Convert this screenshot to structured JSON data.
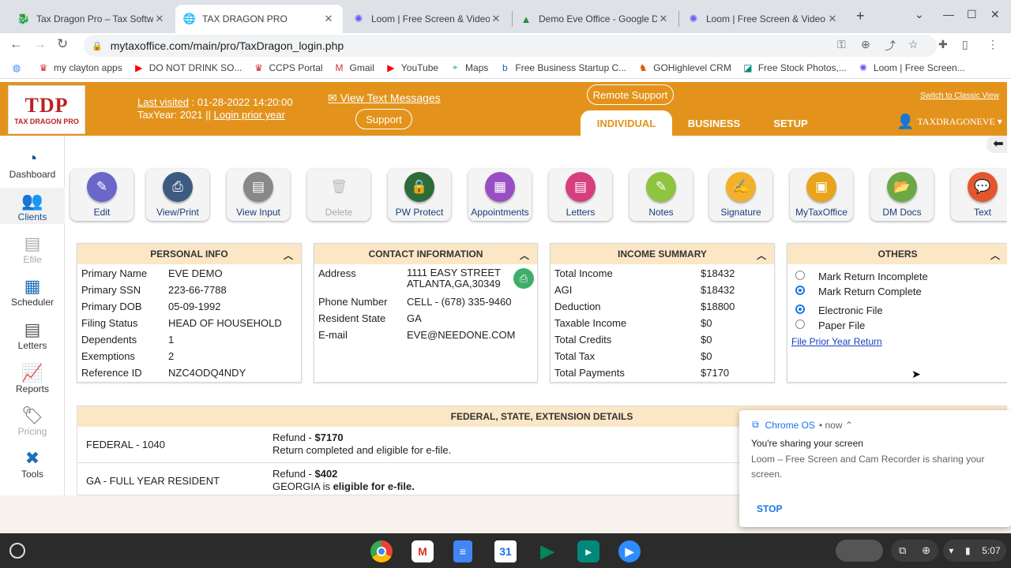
{
  "browser": {
    "tabs": [
      {
        "title": "Tax Dragon Pro – Tax Softwa",
        "icon": "tdp-icon",
        "color": "#c62828"
      },
      {
        "title": "TAX DRAGON PRO",
        "icon": "globe-icon",
        "color": "#5f6368"
      },
      {
        "title": "Loom | Free Screen & Video Re",
        "icon": "loom-icon",
        "color": "#625df5"
      },
      {
        "title": "Demo Eve Office - Google Driv",
        "icon": "drive-icon",
        "color": "#1e8e3e"
      },
      {
        "title": "Loom | Free Screen & Video Re",
        "icon": "loom-icon",
        "color": "#625df5"
      }
    ],
    "new_tab": "+",
    "url": "mytaxoffice.com/main/pro/TaxDragon_login.php",
    "bookmarks": [
      {
        "label": "",
        "icon": "apps-icon"
      },
      {
        "label": "my clayton apps",
        "icon": "bookmark-icon"
      },
      {
        "label": "DO NOT DRINK SO...",
        "icon": "youtube-icon"
      },
      {
        "label": "CCPS Portal",
        "icon": "bookmark-icon"
      },
      {
        "label": "Gmail",
        "icon": "gmail-icon"
      },
      {
        "label": "YouTube",
        "icon": "youtube-icon"
      },
      {
        "label": "Maps",
        "icon": "maps-icon"
      },
      {
        "label": "Free Business Startup C...",
        "icon": "bookmark-icon"
      },
      {
        "label": "GOHighlevel CRM",
        "icon": "bookmark-icon"
      },
      {
        "label": "Free Stock Photos,...",
        "icon": "bookmark-icon"
      },
      {
        "label": "Loom | Free Screen...",
        "icon": "loom-icon"
      }
    ]
  },
  "header": {
    "logo_text": "TDP",
    "logo_sub": "TAX DRAGON PRO",
    "last_visited_label": "Last visited",
    "last_visited_value": " : 01-28-2022 14:20:00",
    "taxyear_label": "TaxYear:  2021  ||",
    "login_prior_year": "Login prior year",
    "view_text_messages": "View Text Messages",
    "remote_support": "Remote Support",
    "support": "Support",
    "switch_classic": "Switch to Classic View",
    "nav_tabs": [
      "INDIVIDUAL",
      "BUSINESS",
      "SETUP"
    ],
    "user": "TAXDRAGONEVE ▾"
  },
  "sidebar": [
    {
      "label": "Dashboard",
      "icon": "dashboard-icon"
    },
    {
      "label": "Clients",
      "icon": "clients-icon"
    },
    {
      "label": "Efile",
      "icon": "efile-icon"
    },
    {
      "label": "Scheduler",
      "icon": "calendar-icon"
    },
    {
      "label": "Letters",
      "icon": "letters-icon"
    },
    {
      "label": "Reports",
      "icon": "reports-icon"
    },
    {
      "label": "Pricing",
      "icon": "pricing-icon"
    },
    {
      "label": "Tools",
      "icon": "tools-icon"
    }
  ],
  "toolbar": [
    {
      "label": "Edit",
      "icon": "edit-icon",
      "color": "#6b66c9"
    },
    {
      "label": "View/Print",
      "icon": "print-icon",
      "color": "#3d5b80"
    },
    {
      "label": "View Input",
      "icon": "view-input-icon",
      "color": "#888888"
    },
    {
      "label": "Delete",
      "icon": "trash-icon",
      "color": "#cccccc"
    },
    {
      "label": "PW Protect",
      "icon": "lock-icon",
      "color": "#2e6b3a"
    },
    {
      "label": "Appointments",
      "icon": "calendar-icon",
      "color": "#9a4ec4"
    },
    {
      "label": "Letters",
      "icon": "letters-icon",
      "color": "#d63f7f"
    },
    {
      "label": "Notes",
      "icon": "notes-icon",
      "color": "#8fc43f"
    },
    {
      "label": "Signature",
      "icon": "signature-icon",
      "color": "#f2b12c"
    },
    {
      "label": "MyTaxOffice",
      "icon": "mytaxoffice-icon",
      "color": "#e8a41b"
    },
    {
      "label": "DM Docs",
      "icon": "folder-icon",
      "color": "#6ea845"
    },
    {
      "label": "Text",
      "icon": "text-icon",
      "color": "#e4572e"
    }
  ],
  "personal": {
    "title": "PERSONAL INFO",
    "rows": [
      [
        "Primary Name",
        "EVE DEMO"
      ],
      [
        "Primary SSN",
        "223-66-7788"
      ],
      [
        "Primary DOB",
        "05-09-1992"
      ],
      [
        "Filing Status",
        "HEAD OF HOUSEHOLD"
      ],
      [
        "Dependents",
        "1"
      ],
      [
        "Exemptions",
        "2"
      ],
      [
        "Reference ID",
        "NZC4ODQ4NDY"
      ]
    ]
  },
  "contact": {
    "title": "CONTACT INFORMATION",
    "address_label": "Address",
    "address_line1": "1111 EASY STREET",
    "address_line2": "ATLANTA,GA,30349",
    "phone_label": "Phone Number",
    "phone": "CELL - (678) 335-9460",
    "state_label": "Resident State",
    "state": "GA",
    "email_label": "E-mail",
    "email": "EVE@NEEDONE.COM"
  },
  "income": {
    "title": "INCOME SUMMARY",
    "rows": [
      [
        "Total Income",
        "$18432"
      ],
      [
        "AGI",
        "$18432"
      ],
      [
        "Deduction",
        "$18800"
      ],
      [
        "Taxable Income",
        "$0"
      ],
      [
        "Total Credits",
        "$0"
      ],
      [
        "Total Tax",
        "$0"
      ],
      [
        "Total Payments",
        "$7170"
      ]
    ]
  },
  "others": {
    "title": "OTHERS",
    "mark_incomplete": "Mark Return Incomplete",
    "mark_complete": "Mark Return Complete",
    "electronic": "Electronic File",
    "paper": "Paper File",
    "prior_year": "File Prior Year Return"
  },
  "federal": {
    "title": "FEDERAL, STATE, EXTENSION DETAILS",
    "rows": [
      {
        "name": "FEDERAL - 1040",
        "line1_prefix": "Refund - ",
        "line1_amount": "$7170",
        "line2_prefix": "Return completed and eligible for e-file.",
        "line2_bold": ""
      },
      {
        "name": "GA - FULL YEAR RESIDENT",
        "line1_prefix": "Refund - ",
        "line1_amount": "$402",
        "line2_prefix": "GEORGIA is ",
        "line2_bold": "eligible for e-file."
      }
    ]
  },
  "notification": {
    "app": "Chrome OS",
    "when": "• now ⌃",
    "title": "You're sharing your screen",
    "body": "Loom – Free Screen and Cam Recorder is sharing your screen.",
    "stop": "STOP"
  },
  "shelf": {
    "time": "5:07",
    "apps": [
      {
        "icon": "chrome-icon",
        "color": "#1a73e8"
      },
      {
        "icon": "gmail-icon",
        "color": "#ffffff"
      },
      {
        "icon": "docs-icon",
        "color": "#4285f4"
      },
      {
        "icon": "calendar-icon",
        "color": "#1a73e8"
      },
      {
        "icon": "play-store-icon",
        "color": "#01875f"
      },
      {
        "icon": "meet-icon",
        "color": "#00897b"
      },
      {
        "icon": "zoom-icon",
        "color": "#2d8cff"
      }
    ]
  }
}
